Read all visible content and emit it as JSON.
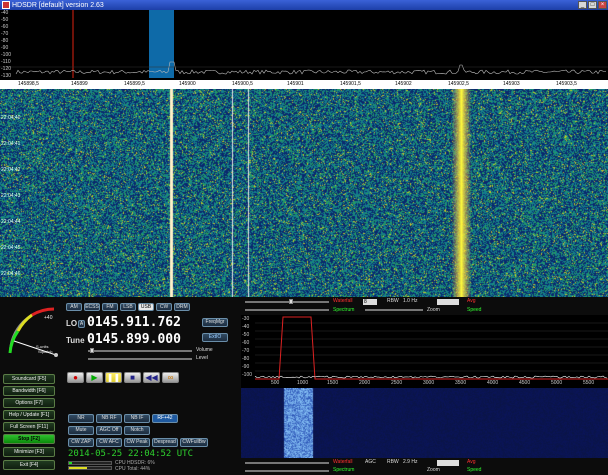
{
  "window": {
    "title": "HDSDR [default]  version 2.63"
  },
  "spectrum": {
    "db_scale": [
      "-40",
      "-50",
      "-60",
      "-70",
      "-80",
      "-90",
      "-100",
      "-110",
      "-120",
      "-130"
    ],
    "freq_labels": [
      "145898,5",
      "145899",
      "145899,5",
      "145900",
      "145900,5",
      "145901",
      "145901,5",
      "145902",
      "145902,5",
      "145903",
      "145903,5"
    ]
  },
  "waterfall": {
    "time_labels": [
      "22:04:40",
      "22:04:41",
      "22:04:42",
      "22:04:43",
      "22:04:44",
      "22:04:45",
      "22:04:46",
      "22:04:47",
      "22:04:48"
    ]
  },
  "smeter": {
    "scale_top": "+40",
    "scale_left": "S-units",
    "scale_bottom": "Squelch"
  },
  "modes": [
    "AM",
    "ECSS",
    "FM",
    "LSB",
    "USB",
    "CW",
    "DRM"
  ],
  "active_mode": "USB",
  "lo": {
    "label": "LO",
    "marker": "A",
    "value": "0145.911.762"
  },
  "tune": {
    "label": "Tune",
    "value": "0145.899.000"
  },
  "volume_label": "Volume",
  "level_label": "Level",
  "freq_mgr_label": "FreqMgr",
  "extio_label": "ExtIO",
  "function_buttons": [
    "Soundcard [F5]",
    "Bandwidth [F6]",
    "Options [F7]",
    "Help / Update [F1]",
    "Full Screen [F11]",
    "Stop [F2]",
    "Minimize [F3]",
    "Exit [F4]"
  ],
  "active_function": "Stop [F2]",
  "dsp_buttons": [
    "NR",
    "NB RF",
    "NB IF",
    "RF+42",
    "Mute",
    "AGC Off",
    "Notch",
    "CW ZAP",
    "CW AFC",
    "CW Peak",
    "Despread",
    "CWFullBw"
  ],
  "status": {
    "date": "2014-05-25",
    "time": "22:04:52 UTC",
    "cpu_hdsdr": "CPU HDSDR: 6%",
    "cpu_total": "CPU Total: 44%"
  },
  "top_controls": {
    "waterfall_label": "Waterfall",
    "spectrum_label": "Spectrum",
    "rbw_label": "RBW",
    "rbw_value": "1.0 Hz",
    "zoom_label": "Zoom",
    "avg_label": "Avg",
    "speed_label": "Speed",
    "select_value": "8"
  },
  "audio": {
    "db_scale": [
      "-30",
      "-40",
      "-50",
      "-60",
      "-70",
      "-80",
      "-90",
      "-100"
    ],
    "hz_labels": [
      "500",
      "1000",
      "1500",
      "2000",
      "2500",
      "3000",
      "3500",
      "4000",
      "4500",
      "5000",
      "5500"
    ]
  },
  "bottom_controls": {
    "waterfall_label": "Waterfall",
    "spectrum_label": "Spectrum",
    "agc_label": "AGC",
    "rbw_label": "RBW",
    "rbw_value": "2.9 Hz",
    "zoom_label": "Zoom",
    "avg_label": "Avg",
    "speed_label": "Speed"
  },
  "colors": {
    "accent_green": "#22c022",
    "waterfall_signal": "#ff8800",
    "label_red": "#ff3030",
    "label_green": "#30ff30"
  }
}
